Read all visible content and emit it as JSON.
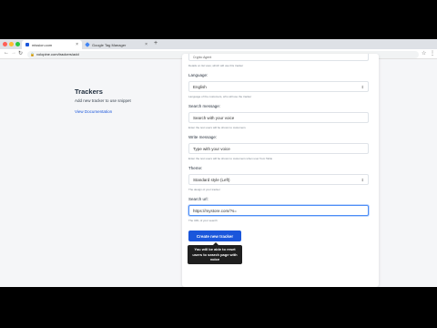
{
  "browser": {
    "tabs": [
      {
        "label": "mission.com",
        "active": true
      },
      {
        "label": "Google Tag Manager",
        "active": false
      }
    ],
    "new_tab_label": "+",
    "url": "volopine.com/trackers/add"
  },
  "sidebar": {
    "title": "Trackers",
    "description": "Add new tracker to use snippet",
    "link": "View Documentation"
  },
  "form": {
    "top_field_value": "Crypto Agent",
    "top_field_help": "Details on list view; which will use this tracker",
    "language": {
      "label": "Language:",
      "value": "English",
      "help": "Language of the customers, who will use the tracker"
    },
    "search_message": {
      "label": "Search message:",
      "placeholder": "Search with your voice",
      "help": "Enter the text users will be shown to customers"
    },
    "write_message": {
      "label": "Write message:",
      "placeholder": "Type with your voice",
      "help": "Enter the text users will be shown to customers when user from Table"
    },
    "theme": {
      "label": "Theme:",
      "value": "Standard style (Left)",
      "help": "The design of your tracker"
    },
    "search_url": {
      "label": "Search url:",
      "value": "https://mystore.com/?s=",
      "help": "The URL of your search"
    },
    "submit_label": "Create new tracker",
    "tooltip": "You will be able to reset users to search page with voice"
  }
}
